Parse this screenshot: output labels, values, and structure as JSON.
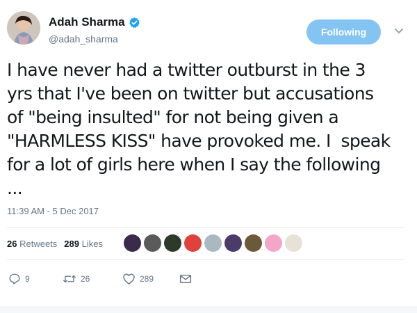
{
  "author": {
    "display_name": "Adah Sharma",
    "handle": "@adah_sharma",
    "verified": true
  },
  "follow_button": {
    "label": "Following"
  },
  "tweet": {
    "text": "I have never had a twitter outburst in the 3\nyrs that I've been on twitter but accusations\nof \"being insulted\" for not being given a\n\"HARMLESS KISS\" have provoked me. I  speak\nfor a lot of girls here when I say the following\n...",
    "timestamp": "11:39 AM - 5 Dec 2017"
  },
  "stats": {
    "retweets_count": "26",
    "retweets_label": "Retweets",
    "likes_count": "289",
    "likes_label": "Likes"
  },
  "liker_avatars": [
    {
      "name": "liker-avatar-1",
      "color": "#3b2a4a"
    },
    {
      "name": "liker-avatar-2",
      "color": "#5a5a5a"
    },
    {
      "name": "liker-avatar-3",
      "color": "#2b3a2b"
    },
    {
      "name": "liker-avatar-4",
      "color": "#e0413a"
    },
    {
      "name": "liker-avatar-5",
      "color": "#aab8c2"
    },
    {
      "name": "liker-avatar-6",
      "color": "#4a3b6b"
    },
    {
      "name": "liker-avatar-7",
      "color": "#6b5a3a"
    },
    {
      "name": "liker-avatar-8",
      "color": "#f4a6c8"
    },
    {
      "name": "liker-avatar-9",
      "color": "#e8e2d6"
    }
  ],
  "actions": {
    "reply_count": "9",
    "retweet_count": "26",
    "like_count": "289"
  },
  "colors": {
    "accent": "#1da1f2",
    "following_button": "#83c4f2",
    "secondary_text": "#657786"
  }
}
